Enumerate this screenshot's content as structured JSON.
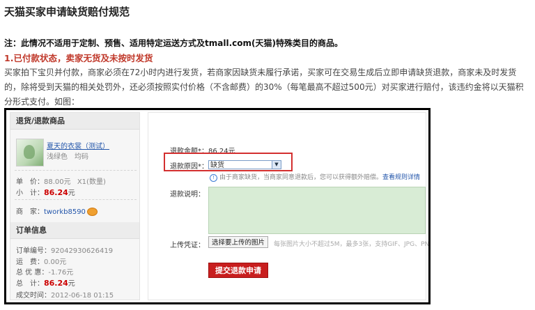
{
  "page": {
    "title": "天猫买家申请缺货赔付规范",
    "note": "注：此情况不适用于定制、预售、适用特定运送方式及tmall.com(天猫)特殊类目的商品。",
    "subheading": "1.已付款状态，卖家无货及未按时发货",
    "paragraph": "买家拍下宝贝并付款，商家必须在72小时内进行发货，若商家因缺货未履行承诺，买家可在交易生成后立即申请缺货退款，商家未及时发货的，除将受到天猫的相关处罚外，还必须按照实付价格（不含邮费）的30%（每笔最高不超过500元）对买家进行赔付，该违约金将以天猫积分形式支付。如图："
  },
  "sidebar": {
    "refund_item_header": "退货/退款商品",
    "item_name": "夏天的衣裳（测试）",
    "item_attrs": "浅绿色　均码",
    "price_label": "单　价：",
    "price_value": "88.00元",
    "quantity": "X1(数量)",
    "subtotal_label": "小　计：",
    "subtotal_value": "86.24",
    "subtotal_unit": "元",
    "seller_label": "商　家：",
    "seller_name": "tworkb8590",
    "order_info_header": "订单信息",
    "order_no_label": "订单编号：",
    "order_no": "92042930626419",
    "shipping_label": "运　费：",
    "shipping_value": "0.00元",
    "discount_label": "总 优 惠：",
    "discount_value": "-1.76元",
    "total_label": "总　计：",
    "total_value": "86.24",
    "total_unit": "元",
    "deal_time_label": "成交时间：",
    "deal_time": "2012-06-18 01:15"
  },
  "form": {
    "refund_amount_label": "退款金额*：",
    "refund_amount_value": "86.24元",
    "refund_reason_label": "退款原因*：",
    "refund_reason_selected": "缺货",
    "reason_hint": "由于商家缺货，当商家同意退款后，您可以获得额外赔偿。",
    "rules_link": "查看规则详情",
    "refund_note_label": "退款说明：",
    "upload_label": "上传凭证：",
    "upload_button": "选择要上传的图片",
    "upload_hint": "每张图片大小不超过5M，最多3张，支持GIF、JPG、PN",
    "submit_button": "提交退款申请"
  },
  "colors": {
    "accent_red": "#c81e1e",
    "highlight_box": "#d32f2f",
    "textarea_bg": "#d8ecd5"
  }
}
